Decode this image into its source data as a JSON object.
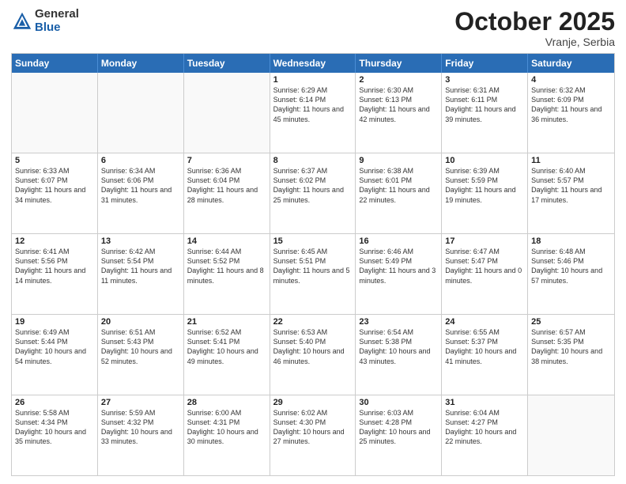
{
  "logo": {
    "general": "General",
    "blue": "Blue"
  },
  "title": "October 2025",
  "subtitle": "Vranje, Serbia",
  "days_of_week": [
    "Sunday",
    "Monday",
    "Tuesday",
    "Wednesday",
    "Thursday",
    "Friday",
    "Saturday"
  ],
  "weeks": [
    [
      {
        "day": "",
        "info": "",
        "empty": true
      },
      {
        "day": "",
        "info": "",
        "empty": true
      },
      {
        "day": "",
        "info": "",
        "empty": true
      },
      {
        "day": "1",
        "info": "Sunrise: 6:29 AM\nSunset: 6:14 PM\nDaylight: 11 hours and 45 minutes."
      },
      {
        "day": "2",
        "info": "Sunrise: 6:30 AM\nSunset: 6:13 PM\nDaylight: 11 hours and 42 minutes."
      },
      {
        "day": "3",
        "info": "Sunrise: 6:31 AM\nSunset: 6:11 PM\nDaylight: 11 hours and 39 minutes."
      },
      {
        "day": "4",
        "info": "Sunrise: 6:32 AM\nSunset: 6:09 PM\nDaylight: 11 hours and 36 minutes."
      }
    ],
    [
      {
        "day": "5",
        "info": "Sunrise: 6:33 AM\nSunset: 6:07 PM\nDaylight: 11 hours and 34 minutes."
      },
      {
        "day": "6",
        "info": "Sunrise: 6:34 AM\nSunset: 6:06 PM\nDaylight: 11 hours and 31 minutes."
      },
      {
        "day": "7",
        "info": "Sunrise: 6:36 AM\nSunset: 6:04 PM\nDaylight: 11 hours and 28 minutes."
      },
      {
        "day": "8",
        "info": "Sunrise: 6:37 AM\nSunset: 6:02 PM\nDaylight: 11 hours and 25 minutes."
      },
      {
        "day": "9",
        "info": "Sunrise: 6:38 AM\nSunset: 6:01 PM\nDaylight: 11 hours and 22 minutes."
      },
      {
        "day": "10",
        "info": "Sunrise: 6:39 AM\nSunset: 5:59 PM\nDaylight: 11 hours and 19 minutes."
      },
      {
        "day": "11",
        "info": "Sunrise: 6:40 AM\nSunset: 5:57 PM\nDaylight: 11 hours and 17 minutes."
      }
    ],
    [
      {
        "day": "12",
        "info": "Sunrise: 6:41 AM\nSunset: 5:56 PM\nDaylight: 11 hours and 14 minutes."
      },
      {
        "day": "13",
        "info": "Sunrise: 6:42 AM\nSunset: 5:54 PM\nDaylight: 11 hours and 11 minutes."
      },
      {
        "day": "14",
        "info": "Sunrise: 6:44 AM\nSunset: 5:52 PM\nDaylight: 11 hours and 8 minutes."
      },
      {
        "day": "15",
        "info": "Sunrise: 6:45 AM\nSunset: 5:51 PM\nDaylight: 11 hours and 5 minutes."
      },
      {
        "day": "16",
        "info": "Sunrise: 6:46 AM\nSunset: 5:49 PM\nDaylight: 11 hours and 3 minutes."
      },
      {
        "day": "17",
        "info": "Sunrise: 6:47 AM\nSunset: 5:47 PM\nDaylight: 11 hours and 0 minutes."
      },
      {
        "day": "18",
        "info": "Sunrise: 6:48 AM\nSunset: 5:46 PM\nDaylight: 10 hours and 57 minutes."
      }
    ],
    [
      {
        "day": "19",
        "info": "Sunrise: 6:49 AM\nSunset: 5:44 PM\nDaylight: 10 hours and 54 minutes."
      },
      {
        "day": "20",
        "info": "Sunrise: 6:51 AM\nSunset: 5:43 PM\nDaylight: 10 hours and 52 minutes."
      },
      {
        "day": "21",
        "info": "Sunrise: 6:52 AM\nSunset: 5:41 PM\nDaylight: 10 hours and 49 minutes."
      },
      {
        "day": "22",
        "info": "Sunrise: 6:53 AM\nSunset: 5:40 PM\nDaylight: 10 hours and 46 minutes."
      },
      {
        "day": "23",
        "info": "Sunrise: 6:54 AM\nSunset: 5:38 PM\nDaylight: 10 hours and 43 minutes."
      },
      {
        "day": "24",
        "info": "Sunrise: 6:55 AM\nSunset: 5:37 PM\nDaylight: 10 hours and 41 minutes."
      },
      {
        "day": "25",
        "info": "Sunrise: 6:57 AM\nSunset: 5:35 PM\nDaylight: 10 hours and 38 minutes."
      }
    ],
    [
      {
        "day": "26",
        "info": "Sunrise: 5:58 AM\nSunset: 4:34 PM\nDaylight: 10 hours and 35 minutes."
      },
      {
        "day": "27",
        "info": "Sunrise: 5:59 AM\nSunset: 4:32 PM\nDaylight: 10 hours and 33 minutes."
      },
      {
        "day": "28",
        "info": "Sunrise: 6:00 AM\nSunset: 4:31 PM\nDaylight: 10 hours and 30 minutes."
      },
      {
        "day": "29",
        "info": "Sunrise: 6:02 AM\nSunset: 4:30 PM\nDaylight: 10 hours and 27 minutes."
      },
      {
        "day": "30",
        "info": "Sunrise: 6:03 AM\nSunset: 4:28 PM\nDaylight: 10 hours and 25 minutes."
      },
      {
        "day": "31",
        "info": "Sunrise: 6:04 AM\nSunset: 4:27 PM\nDaylight: 10 hours and 22 minutes."
      },
      {
        "day": "",
        "info": "",
        "empty": true
      }
    ]
  ]
}
